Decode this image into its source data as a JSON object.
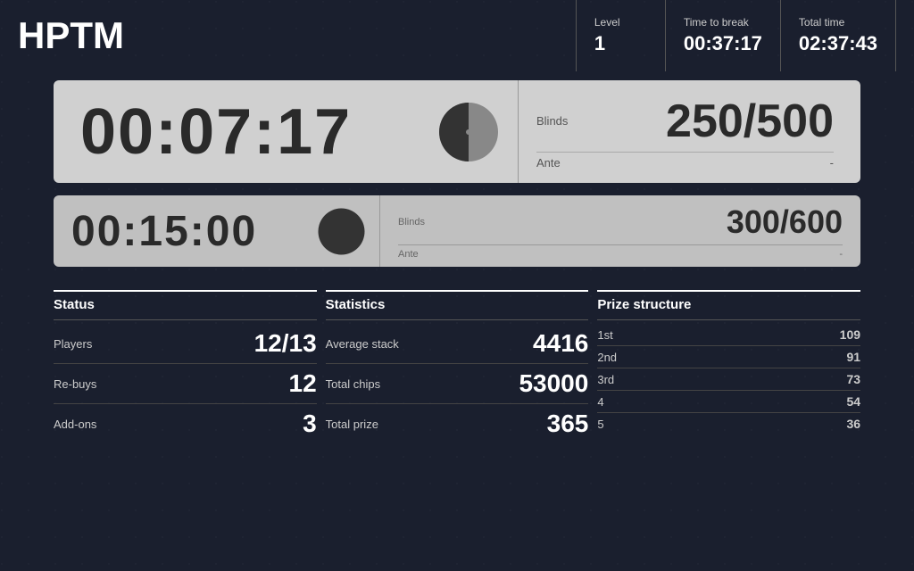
{
  "header": {
    "logo": "HPTM",
    "level_label": "Level",
    "level_value": "1",
    "time_to_break_label": "Time to break",
    "time_to_break_value": "00:37:17",
    "total_time_label": "Total time",
    "total_time_value": "02:37:43"
  },
  "primary_timer": {
    "time": "00:07:17",
    "blinds_label": "Blinds",
    "blinds_value": "250/500",
    "ante_label": "Ante",
    "ante_value": "-",
    "pie_fill": 0.45
  },
  "secondary_timer": {
    "time": "00:15:00",
    "blinds_label": "Blinds",
    "blinds_value": "300/600",
    "ante_label": "Ante",
    "ante_value": "-",
    "pie_fill": 0
  },
  "status": {
    "title": "Status",
    "rows": [
      {
        "label": "Players",
        "value": "12/13"
      },
      {
        "label": "Re-buys",
        "value": "12"
      },
      {
        "label": "Add-ons",
        "value": "3"
      }
    ]
  },
  "statistics": {
    "title": "Statistics",
    "rows": [
      {
        "label": "Average stack",
        "value": "4416"
      },
      {
        "label": "Total chips",
        "value": "53000"
      },
      {
        "label": "Total prize",
        "value": "365"
      }
    ]
  },
  "prize_structure": {
    "title": "Prize structure",
    "rows": [
      {
        "label": "1st",
        "value": "109"
      },
      {
        "label": "2nd",
        "value": "91"
      },
      {
        "label": "3rd",
        "value": "73"
      },
      {
        "label": "4",
        "value": "54"
      },
      {
        "label": "5",
        "value": "36"
      }
    ]
  }
}
